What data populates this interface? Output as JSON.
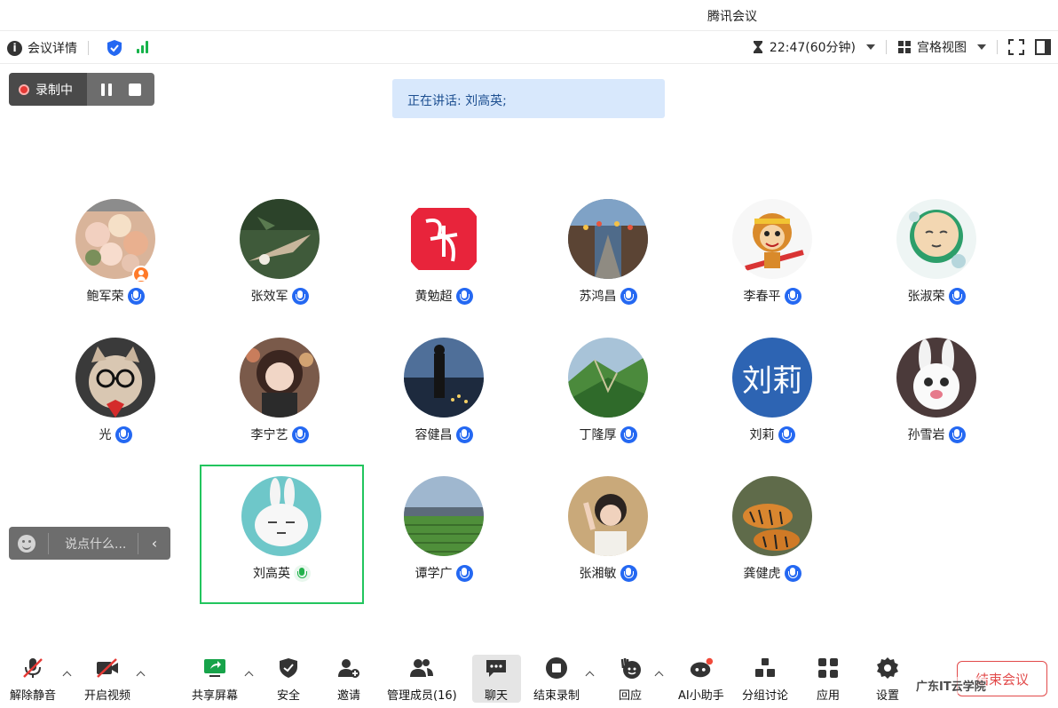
{
  "window": {
    "title": "腾讯会议"
  },
  "top_toolbar": {
    "meeting_info_label": "会议详情",
    "timer": "22:47(60分钟)",
    "view_mode": "宫格视图"
  },
  "recording": {
    "label": "录制中"
  },
  "speaking_banner": "正在讲话: 刘高英;",
  "participants": [
    {
      "name": "鲍军荣"
    },
    {
      "name": "张效军"
    },
    {
      "name": "黄勉超"
    },
    {
      "name": "苏鸿昌"
    },
    {
      "name": "李春平"
    },
    {
      "name": "张淑荣"
    },
    {
      "name": "光"
    },
    {
      "name": "李宁艺"
    },
    {
      "name": "容健昌"
    },
    {
      "name": "丁隆厚"
    },
    {
      "name": "刘莉",
      "avatar_text": "刘莉"
    },
    {
      "name": "孙雪岩"
    },
    {
      "name": "刘高英"
    },
    {
      "name": "谭学广"
    },
    {
      "name": "张湘敏"
    },
    {
      "name": "龚健虎"
    }
  ],
  "chat_input": {
    "placeholder": "说点什么..."
  },
  "bottom_toolbar": {
    "unmute": "解除静音",
    "start_video": "开启视频",
    "share_screen": "共享屏幕",
    "security": "安全",
    "invite": "邀请",
    "manage_members": "管理成员(16)",
    "chat": "聊天",
    "end_recording": "结束录制",
    "reactions": "回应",
    "ai_assistant": "AI小助手",
    "breakout": "分组讨论",
    "apps": "应用",
    "settings": "设置",
    "end_meeting": "结束会议"
  },
  "watermark": "广东IT云学院",
  "colors": {
    "accent_blue": "#2468f2",
    "active_green": "#22c55e",
    "record_red": "#e53935",
    "end_red": "#e24a4a"
  }
}
